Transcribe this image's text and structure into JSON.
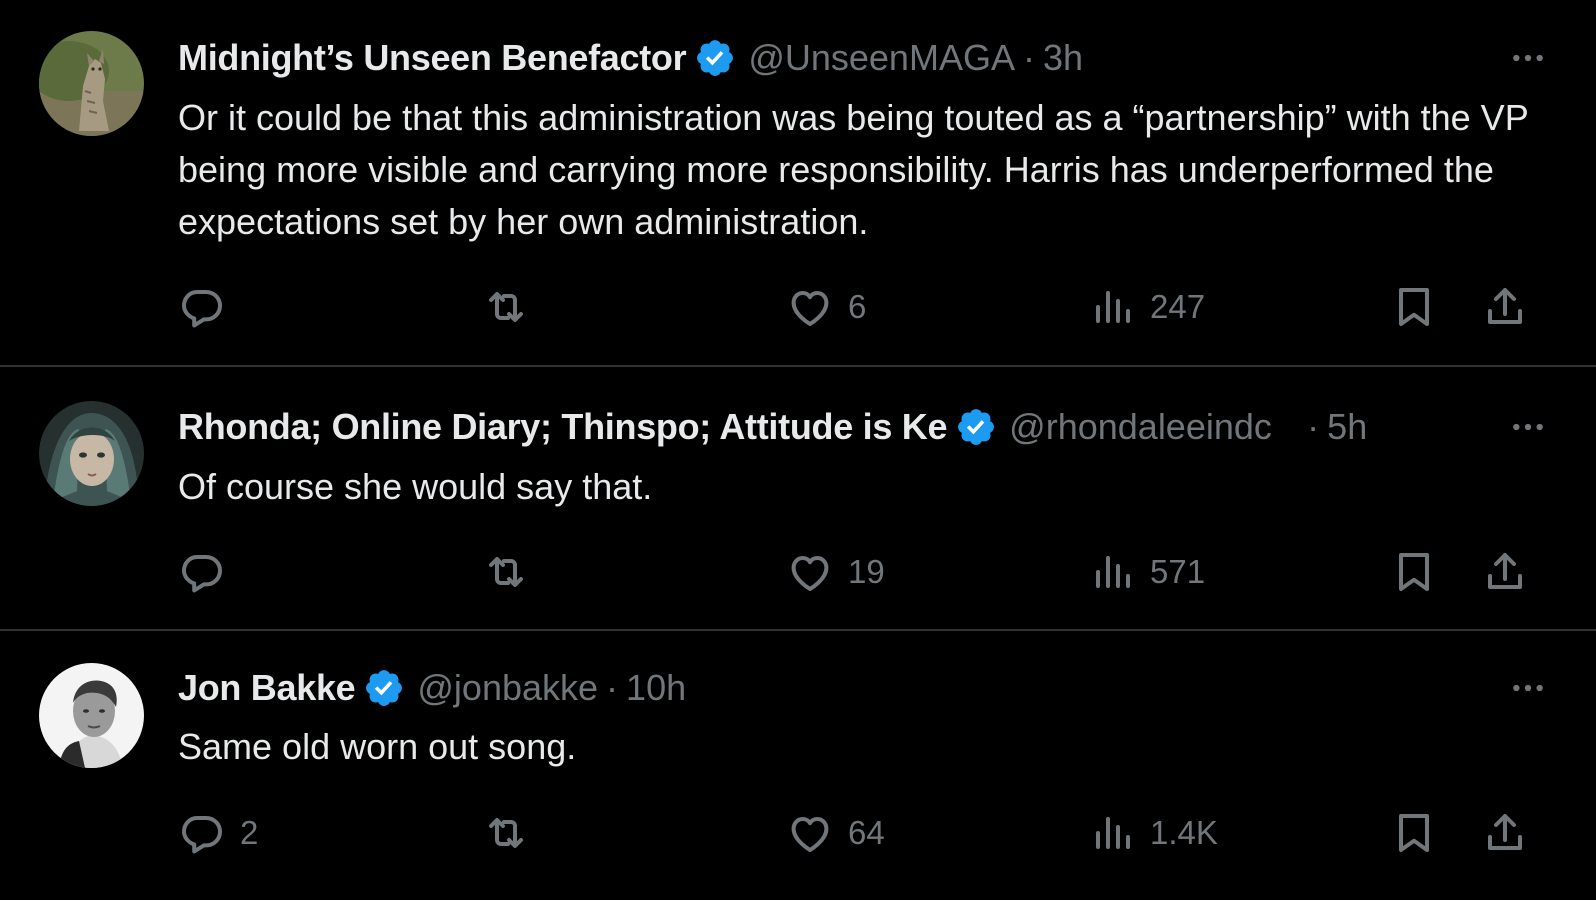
{
  "colors": {
    "background": "#000000",
    "text_primary": "#e7e9ea",
    "text_secondary": "#71767b",
    "verified": "#1d9bf0",
    "divider": "#2f3336"
  },
  "tweets": [
    {
      "name": "Midnight’s Unseen Benefactor",
      "handle": "@UnseenMAGA",
      "separator": "·",
      "time": "3h",
      "text": "Or it could be that this administration was being touted as a “partnership” with the VP being more visible and carrying more responsibility. Harris has underperformed the expectations set by her own administration.",
      "replies": "",
      "likes": "6",
      "views": "247",
      "avatar_icon": "cat-avatar"
    },
    {
      "name": "Rhonda; Online Diary; Thinspo; Attitude is Ke",
      "handle": "@rhondaleeindc",
      "separator": "·",
      "time": "5h",
      "text": "Of course she would say that.",
      "replies": "",
      "likes": "19",
      "views": "571",
      "avatar_icon": "painted-face-avatar"
    },
    {
      "name": "Jon Bakke",
      "handle": "@jonbakke",
      "separator": "·",
      "time": "10h",
      "text": "Same old worn out song.",
      "replies": "2",
      "likes": "64",
      "views": "1.4K",
      "avatar_icon": "man-photo-avatar"
    }
  ],
  "icons": {
    "reply": "reply-icon",
    "retweet": "retweet-icon",
    "like": "heart-icon",
    "views": "views-icon",
    "bookmark": "bookmark-icon",
    "share": "share-icon",
    "more": "more-dots-icon",
    "verified": "verified-badge-icon"
  }
}
